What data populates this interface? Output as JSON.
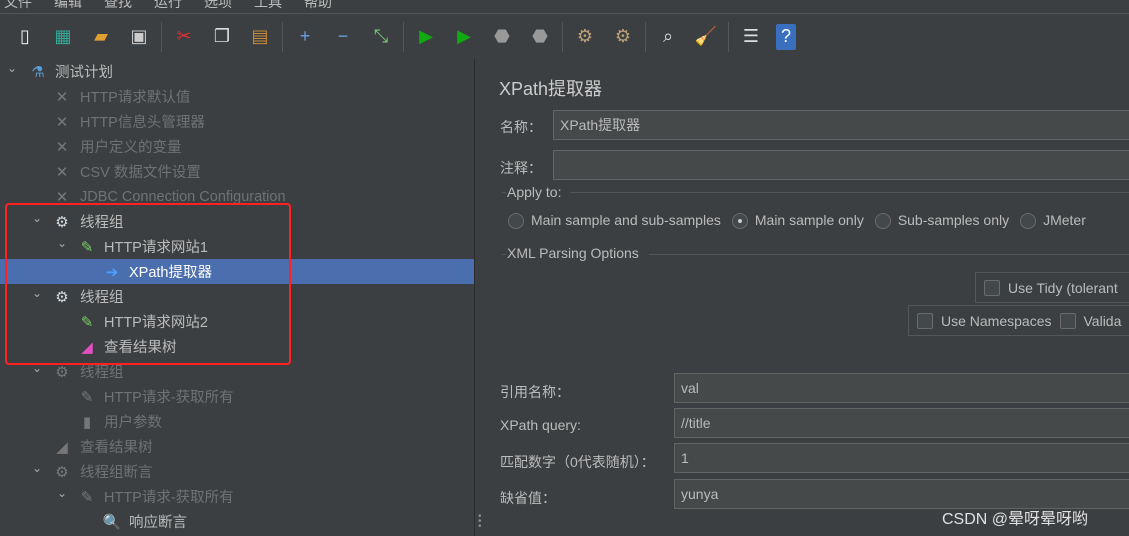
{
  "menu": [
    "文件",
    "编辑",
    "查找",
    "运行",
    "选项",
    "工具",
    "帮助"
  ],
  "toolbar": [
    {
      "name": "new-icon",
      "glyph": "▯",
      "color": "#eee"
    },
    {
      "name": "templates-icon",
      "glyph": "▦",
      "color": "#3a9"
    },
    {
      "name": "open-icon",
      "glyph": "▰",
      "color": "#e0a030"
    },
    {
      "name": "save-icon",
      "glyph": "▣",
      "color": "#ccc"
    },
    {
      "sep": true
    },
    {
      "name": "cut-icon",
      "glyph": "✂",
      "color": "#e03030"
    },
    {
      "name": "copy-icon",
      "glyph": "❐",
      "color": "#ddd"
    },
    {
      "name": "paste-icon",
      "glyph": "▤",
      "color": "#c88a3a"
    },
    {
      "sep": true
    },
    {
      "name": "expand-icon",
      "glyph": "+",
      "color": "#6aa0e0"
    },
    {
      "name": "collapse-icon",
      "glyph": "−",
      "color": "#6aa0e0"
    },
    {
      "name": "toggle-icon",
      "glyph": "⤡",
      "color": "#7c7"
    },
    {
      "sep": true
    },
    {
      "name": "start-icon",
      "glyph": "▶",
      "color": "#1a1"
    },
    {
      "name": "start-no-pauses-icon",
      "glyph": "▶",
      "color": "#1a1"
    },
    {
      "name": "stop-icon",
      "glyph": "⬣",
      "color": "#999"
    },
    {
      "name": "shutdown-icon",
      "glyph": "⬣",
      "color": "#999"
    },
    {
      "sep": true
    },
    {
      "name": "clear-icon",
      "glyph": "⚙",
      "color": "#b9a07a"
    },
    {
      "name": "clear-all-icon",
      "glyph": "⚙",
      "color": "#b9a07a"
    },
    {
      "sep": true
    },
    {
      "name": "search-icon",
      "glyph": "⌕",
      "color": "#ddd"
    },
    {
      "name": "reset-search-icon",
      "glyph": "🧹",
      "color": "#e8c020"
    },
    {
      "sep": true
    },
    {
      "name": "function-helper-icon",
      "glyph": "☰",
      "color": "#ddd"
    },
    {
      "name": "help-icon",
      "glyph": "?",
      "color": "#fff"
    }
  ],
  "tree": [
    {
      "label": "测试计划",
      "depth": 0,
      "caret": "⌄",
      "icon": "flask-icon",
      "glyph": "⚗",
      "color": "#5b9bd5",
      "state": "normal"
    },
    {
      "label": "HTTP请求默认值",
      "depth": 1,
      "icon": "config-element-icon",
      "glyph": "✕",
      "color": "#777",
      "state": "disabled"
    },
    {
      "label": "HTTP信息头管理器",
      "depth": 1,
      "icon": "config-element-icon",
      "glyph": "✕",
      "color": "#777",
      "state": "disabled"
    },
    {
      "label": "用户定义的变量",
      "depth": 1,
      "icon": "config-element-icon",
      "glyph": "✕",
      "color": "#777",
      "state": "disabled"
    },
    {
      "label": "CSV 数据文件设置",
      "depth": 1,
      "icon": "config-element-icon",
      "glyph": "✕",
      "color": "#777",
      "state": "disabled"
    },
    {
      "label": "JDBC Connection Configuration",
      "depth": 1,
      "icon": "config-element-icon",
      "glyph": "✕",
      "color": "#777",
      "state": "disabled"
    },
    {
      "label": "线程组",
      "depth": 1,
      "caret": "⌄",
      "icon": "thread-group-icon",
      "glyph": "⚙",
      "color": "#cfd8e0",
      "state": "normal"
    },
    {
      "label": "HTTP请求网站1",
      "depth": 2,
      "caret": "⌄",
      "icon": "sampler-pipette-icon",
      "glyph": "✎",
      "color": "#7c6",
      "state": "normal"
    },
    {
      "label": "XPath提取器",
      "depth": 3,
      "icon": "extractor-icon",
      "glyph": "➔",
      "color": "#4aa0ff",
      "state": "selected"
    },
    {
      "label": "线程组",
      "depth": 1,
      "caret": "⌄",
      "icon": "thread-group-icon",
      "glyph": "⚙",
      "color": "#cfd8e0",
      "state": "normal"
    },
    {
      "label": "HTTP请求网站2",
      "depth": 2,
      "icon": "sampler-pipette-icon",
      "glyph": "✎",
      "color": "#7c6",
      "state": "normal"
    },
    {
      "label": "查看结果树",
      "depth": 2,
      "icon": "listener-icon",
      "glyph": "◢",
      "color": "#e050c0",
      "state": "normal"
    },
    {
      "label": "线程组",
      "depth": 1,
      "caret": "⌄",
      "icon": "thread-group-icon",
      "glyph": "⚙",
      "color": "#777",
      "state": "disabled"
    },
    {
      "label": "HTTP请求-获取所有",
      "depth": 2,
      "icon": "sampler-pipette-icon",
      "glyph": "✎",
      "color": "#777",
      "state": "disabled"
    },
    {
      "label": "用户参数",
      "depth": 2,
      "icon": "preprocessor-icon",
      "glyph": "▮",
      "color": "#777",
      "state": "disabled"
    },
    {
      "label": "查看结果树",
      "depth": 1,
      "icon": "listener-icon",
      "glyph": "◢",
      "color": "#777",
      "state": "disabled"
    },
    {
      "label": "线程组断言",
      "depth": 1,
      "caret": "⌄",
      "icon": "thread-group-icon",
      "glyph": "⚙",
      "color": "#777",
      "state": "disabled"
    },
    {
      "label": "HTTP请求-获取所有",
      "depth": 2,
      "caret": "⌄",
      "icon": "sampler-pipette-icon",
      "glyph": "✎",
      "color": "#777",
      "state": "disabled"
    },
    {
      "label": "响应断言",
      "depth": 3,
      "icon": "assertion-icon",
      "glyph": "🔍",
      "color": "#ddd",
      "state": "normal"
    }
  ],
  "panel": {
    "title": "XPath提取器",
    "name_label": "名称：",
    "name_value": "XPath提取器",
    "comment_label": "注释：",
    "comment_value": "",
    "apply_to": {
      "legend": "Apply to:",
      "options": [
        {
          "label": "Main sample and sub-samples",
          "checked": false
        },
        {
          "label": "Main sample only",
          "checked": true
        },
        {
          "label": "Sub-samples only",
          "checked": false
        },
        {
          "label": "JMeter",
          "checked": false
        }
      ]
    },
    "xml_options": {
      "legend": "XML Parsing Options",
      "use_tidy": "Use Tidy (tolerant",
      "use_namespaces": "Use Namespaces",
      "validate": "Valida"
    },
    "fields": [
      {
        "label": "引用名称：",
        "value": "val"
      },
      {
        "label": "XPath query:",
        "value": "//title"
      },
      {
        "label": "匹配数字（0代表随机）：",
        "value": "1"
      },
      {
        "label": "缺省值：",
        "value": "yunya"
      }
    ]
  },
  "watermark": "CSDN @晕呀晕呀哟"
}
